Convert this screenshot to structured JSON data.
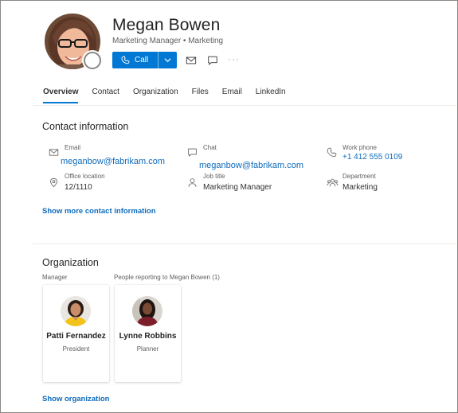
{
  "profile": {
    "name": "Megan Bowen",
    "subtitle": "Marketing Manager • Marketing",
    "call_label": "Call",
    "more_label": "···"
  },
  "tabs": [
    {
      "label": "Overview",
      "active": true
    },
    {
      "label": "Contact"
    },
    {
      "label": "Organization"
    },
    {
      "label": "Files"
    },
    {
      "label": "Email"
    },
    {
      "label": "LinkedIn"
    }
  ],
  "contact": {
    "title": "Contact information",
    "email_label": "Email",
    "email_value": "meganbow@fabrikam.com",
    "chat_label": "Chat",
    "chat_value": "meganbow@fabrikam.com",
    "work_phone_label": "Work phone",
    "work_phone_value": "+1 412 555 0109",
    "office_label": "Office location",
    "office_value": "12/1110",
    "job_label": "Job title",
    "job_value": "Marketing Manager",
    "dept_label": "Department",
    "dept_value": "Marketing",
    "show_more": "Show more contact information"
  },
  "organization": {
    "title": "Organization",
    "manager_label": "Manager",
    "reports_label": "People reporting to Megan Bowen (1)",
    "manager": {
      "name": "Patti Fernandez",
      "role": "President"
    },
    "report": {
      "name": "Lynne Robbins",
      "role": "Planner"
    },
    "show_org": "Show organization"
  },
  "icons": {
    "call": "phone-icon",
    "mail": "mail-icon",
    "chat": "chat-icon",
    "location": "location-pin-icon",
    "person": "person-icon",
    "department": "people-icon"
  },
  "colors": {
    "accent": "#0078d4",
    "link": "#0f6cbd"
  }
}
